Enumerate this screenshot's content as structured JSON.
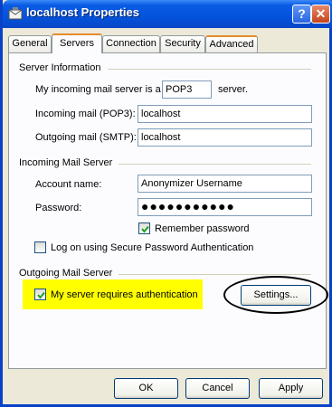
{
  "window": {
    "title": "localhost Properties",
    "help_label": "?",
    "close_label": "✕"
  },
  "tabs": [
    {
      "label": "General"
    },
    {
      "label": "Servers"
    },
    {
      "label": "Connection"
    },
    {
      "label": "Security"
    },
    {
      "label": "Advanced"
    }
  ],
  "server_info": {
    "group_label": "Server Information",
    "prefix": "My incoming mail server is a",
    "type_value": "POP3",
    "suffix": "server.",
    "incoming_label": "Incoming mail (POP3):",
    "incoming_value": "localhost",
    "outgoing_label": "Outgoing mail (SMTP):",
    "outgoing_value": "localhost"
  },
  "incoming_server": {
    "group_label": "Incoming Mail Server",
    "account_label": "Account name:",
    "account_value": "Anonymizer Username",
    "password_label": "Password:",
    "password_value": "●●●●●●●●●●●",
    "remember_label": "Remember password",
    "remember_checked": true,
    "spa_label": "Log on using Secure Password Authentication",
    "spa_checked": false
  },
  "outgoing_server": {
    "group_label": "Outgoing Mail Server",
    "auth_label": "My server requires authentication",
    "auth_checked": true,
    "settings_label": "Settings...",
    "highlight_color": "#ffff00"
  },
  "buttons": {
    "ok": "OK",
    "cancel": "Cancel",
    "apply": "Apply"
  }
}
